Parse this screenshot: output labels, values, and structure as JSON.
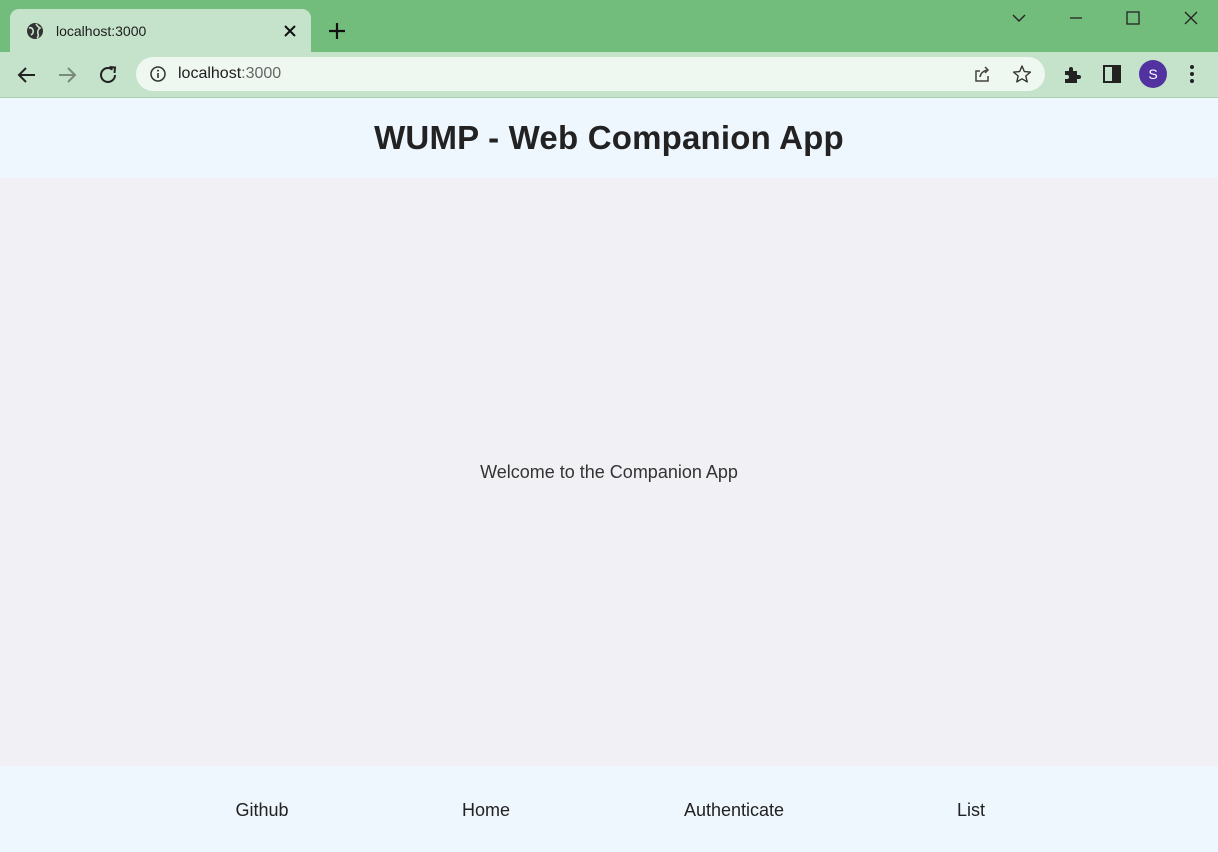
{
  "browser": {
    "tab_title": "localhost:3000",
    "url_host": "localhost",
    "url_port": ":3000",
    "avatar_letter": "S",
    "icons": [
      "globe-icon",
      "close-icon",
      "plus-icon",
      "chevron-down-icon",
      "minimize-icon",
      "maximize-icon",
      "window-close-icon",
      "back-arrow-icon",
      "forward-arrow-icon",
      "reload-icon",
      "info-icon",
      "share-icon",
      "star-icon",
      "extensions-icon",
      "side-panel-icon",
      "kebab-menu-icon"
    ],
    "colors": {
      "tabstrip": "#72bd7b",
      "toolbar": "#c4e3ca",
      "avatar": "#5132a0"
    }
  },
  "page": {
    "title": "WUMP - Web Companion App",
    "welcome": "Welcome to the Companion App",
    "footer_links": [
      "Github",
      "Home",
      "Authenticate",
      "List"
    ],
    "colors": {
      "header_bg": "#eef6fe",
      "main_bg": "#f1f1f5"
    }
  }
}
